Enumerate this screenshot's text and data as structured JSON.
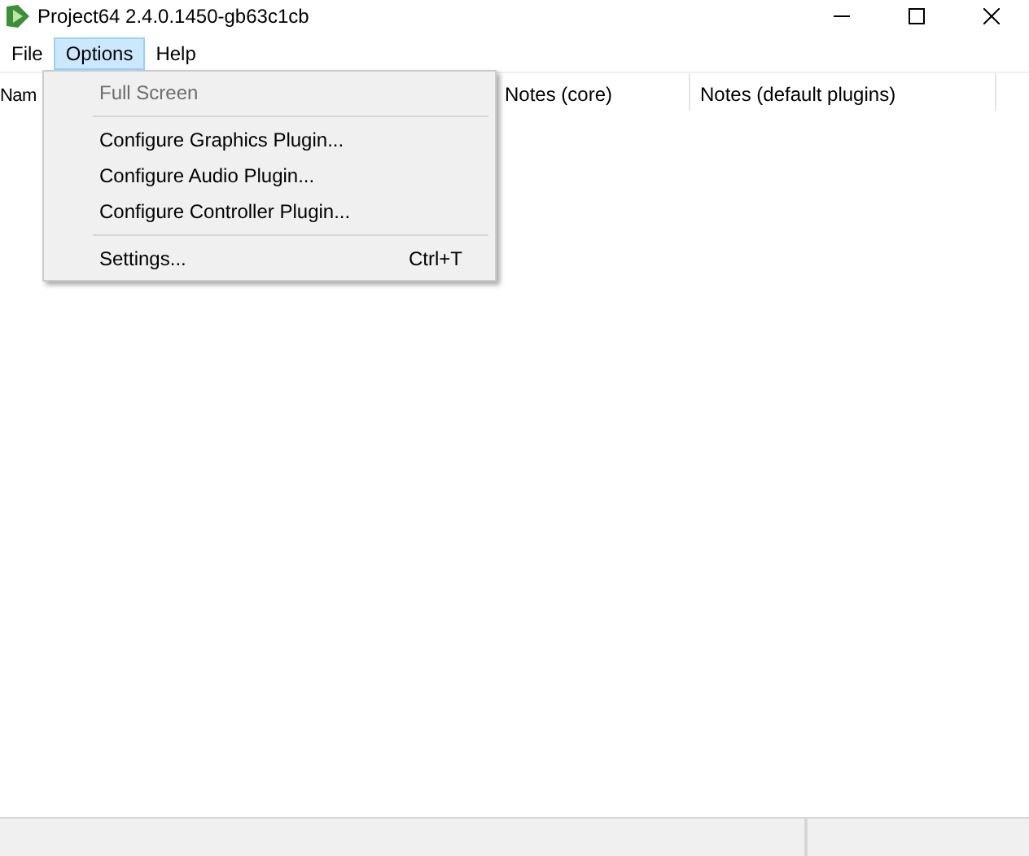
{
  "window": {
    "title": "Project64 2.4.0.1450-gb63c1cb"
  },
  "menubar": [
    {
      "label": "File",
      "selected": false
    },
    {
      "label": "Options",
      "selected": true
    },
    {
      "label": "Help",
      "selected": false
    }
  ],
  "table": {
    "columns": [
      "Nam",
      "Notes (core)",
      "Notes (default plugins)"
    ]
  },
  "menu": [
    {
      "kind": "item",
      "label": "Full Screen",
      "disabled": true
    },
    {
      "kind": "separator"
    },
    {
      "kind": "item",
      "label": "Configure Graphics Plugin...",
      "disabled": false
    },
    {
      "kind": "item",
      "label": "Configure Audio Plugin...",
      "disabled": false
    },
    {
      "kind": "item",
      "label": "Configure Controller Plugin...",
      "disabled": false
    },
    {
      "kind": "separator"
    },
    {
      "kind": "item",
      "label": "Settings...",
      "disabled": false,
      "shortcut": "Ctrl+T"
    }
  ]
}
